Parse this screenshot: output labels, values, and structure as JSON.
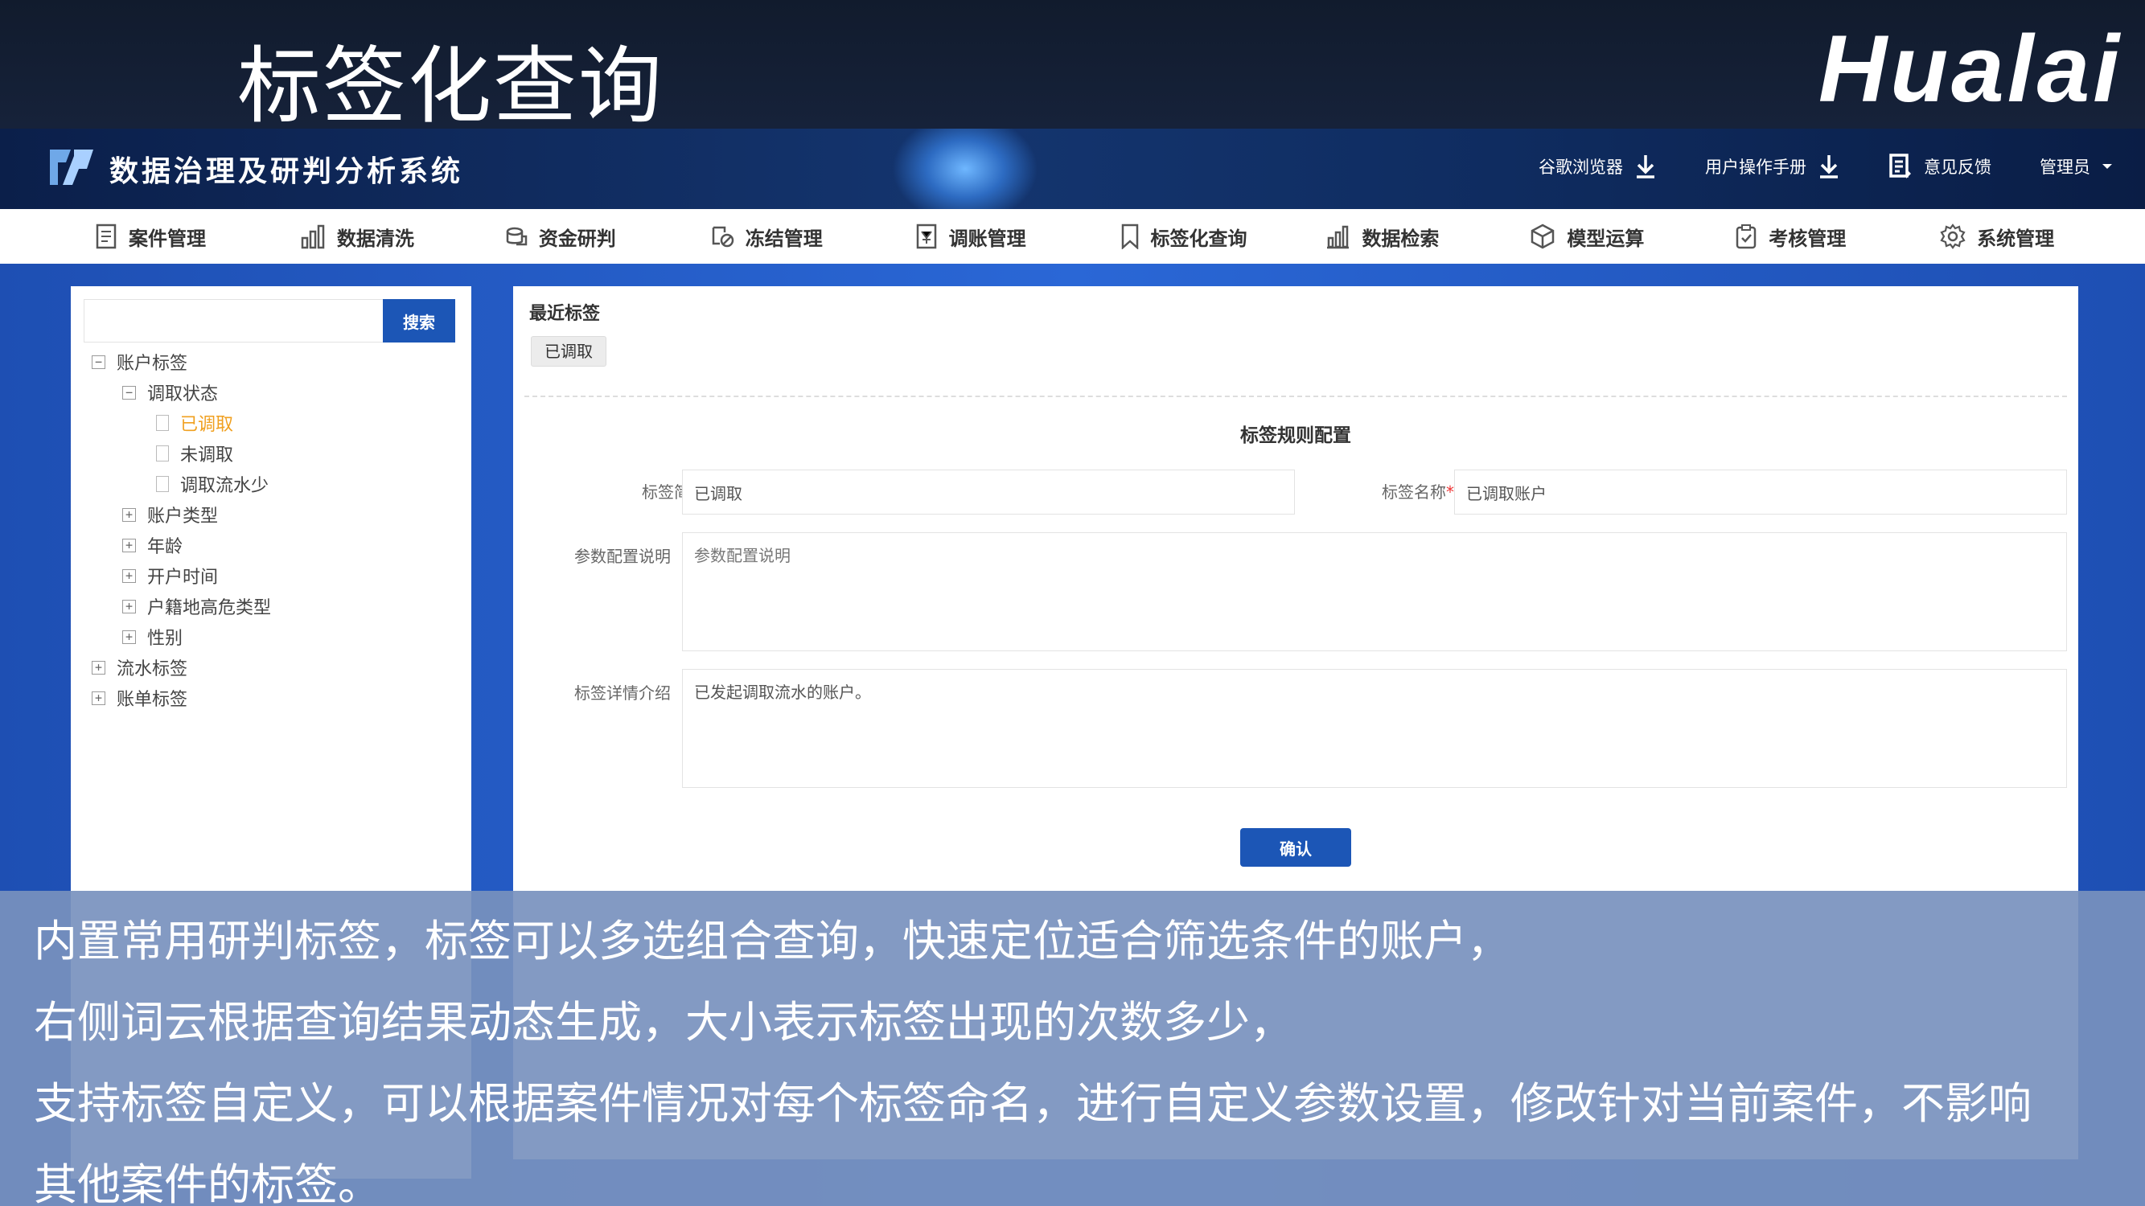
{
  "banner": {
    "title": "标签化查询",
    "brand": "Hualai"
  },
  "header": {
    "app_name": "数据治理及研判分析系统",
    "tools": [
      {
        "label": "谷歌浏览器",
        "icon": "download-icon"
      },
      {
        "label": "用户操作手册",
        "icon": "download-icon"
      },
      {
        "label": "意见反馈",
        "icon": "feedback-icon"
      },
      {
        "label": "管理员",
        "icon": "caret-down-icon"
      }
    ]
  },
  "nav": {
    "items": [
      {
        "label": "案件管理",
        "icon": "document-icon"
      },
      {
        "label": "数据清洗",
        "icon": "bar-chart-icon"
      },
      {
        "label": "资金研判",
        "icon": "coins-icon"
      },
      {
        "label": "冻结管理",
        "icon": "freeze-icon"
      },
      {
        "label": "调账管理",
        "icon": "account-icon"
      },
      {
        "label": "标签化查询",
        "icon": "bookmark-icon"
      },
      {
        "label": "数据检索",
        "icon": "chart-icon"
      },
      {
        "label": "模型运算",
        "icon": "cube-icon"
      },
      {
        "label": "考核管理",
        "icon": "clipboard-icon"
      },
      {
        "label": "系统管理",
        "icon": "gear-icon"
      }
    ]
  },
  "sidebar": {
    "search_placeholder": "",
    "search_button": "搜索",
    "tree": {
      "account_tags": "账户标签",
      "retrieval_status": "调取状态",
      "retrieved": "已调取",
      "not_retrieved": "未调取",
      "low_flow": "调取流水少",
      "account_type": "账户类型",
      "age": "年龄",
      "open_time": "开户时间",
      "hometown_risk": "户籍地高危类型",
      "gender": "性别",
      "flow_tags": "流水标签",
      "bill_tags": "账单标签"
    }
  },
  "main": {
    "recent_title": "最近标签",
    "recent_tag": "已调取",
    "section_title": "标签规则配置",
    "short_name_label": "标签简称",
    "short_name_value": "已调取",
    "full_name_label": "标签名称",
    "full_name_value": "已调取账户",
    "param_label": "参数配置说明",
    "param_placeholder": "参数配置说明",
    "detail_label": "标签详情介绍",
    "detail_value": "已发起调取流水的账户。",
    "confirm_button": "确认",
    "required_mark": "*"
  },
  "caption": {
    "lines": [
      "内置常用研判标签，标签可以多选组合查询，快速定位适合筛选条件的账户，",
      "右侧词云根据查询结果动态生成，大小表示标签出现的次数多少，",
      "支持标签自定义，可以根据案件情况对每个标签命名，进行自定义参数设置，修改针对当前案件，不影响",
      "其他案件的标签。"
    ]
  },
  "colors": {
    "primary": "#1c56b6",
    "active_tag": "#f0a020",
    "content_bg": "#2a67d6"
  }
}
